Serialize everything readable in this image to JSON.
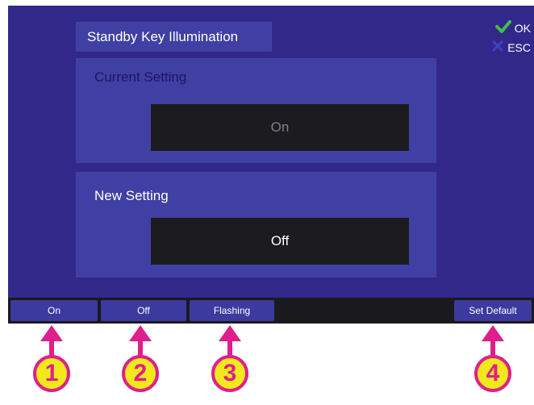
{
  "screen": {
    "title": "Standby Key Illumination",
    "ok_label": "OK",
    "esc_label": "ESC"
  },
  "current_setting": {
    "label": "Current Setting",
    "value": "On"
  },
  "new_setting": {
    "label": "New Setting",
    "value": "Off"
  },
  "softkeys": [
    {
      "label": "On",
      "callout": "1"
    },
    {
      "label": "Off",
      "callout": "2"
    },
    {
      "label": "Flashing",
      "callout": "3"
    },
    {
      "label": "Set Default",
      "callout": "4"
    }
  ],
  "colors": {
    "screen_bg": "#32288a",
    "panel_bg": "#4040a4",
    "callout": "#e01e8c",
    "callout_fill": "#f3e81c",
    "ok_check": "#3ec24a",
    "esc_x": "#3a44c8"
  },
  "icons": {
    "ok": "check-icon",
    "esc": "x-icon"
  }
}
